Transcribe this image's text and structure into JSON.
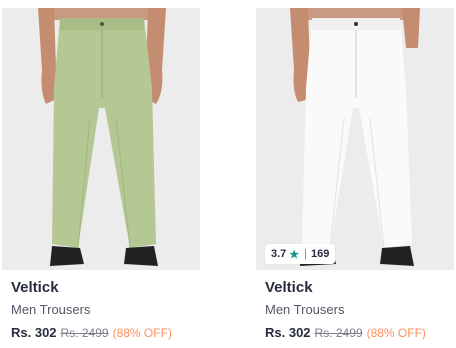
{
  "products": [
    {
      "brand": "Veltick",
      "name": "Men Trousers",
      "price": "Rs. 302",
      "mrp": "Rs. 2499",
      "discount": "(88% OFF)",
      "trouser_color": "#b5c893"
    },
    {
      "brand": "Veltick",
      "name": "Men Trousers",
      "price": "Rs. 302",
      "mrp": "Rs. 2499",
      "discount": "(88% OFF)",
      "trouser_color": "#fafafa",
      "rating": "3.7",
      "rating_icon": "star-icon",
      "rating_count": "169"
    }
  ],
  "colors": {
    "accent_discount": "#ff905a",
    "rating_star": "#14958f"
  }
}
